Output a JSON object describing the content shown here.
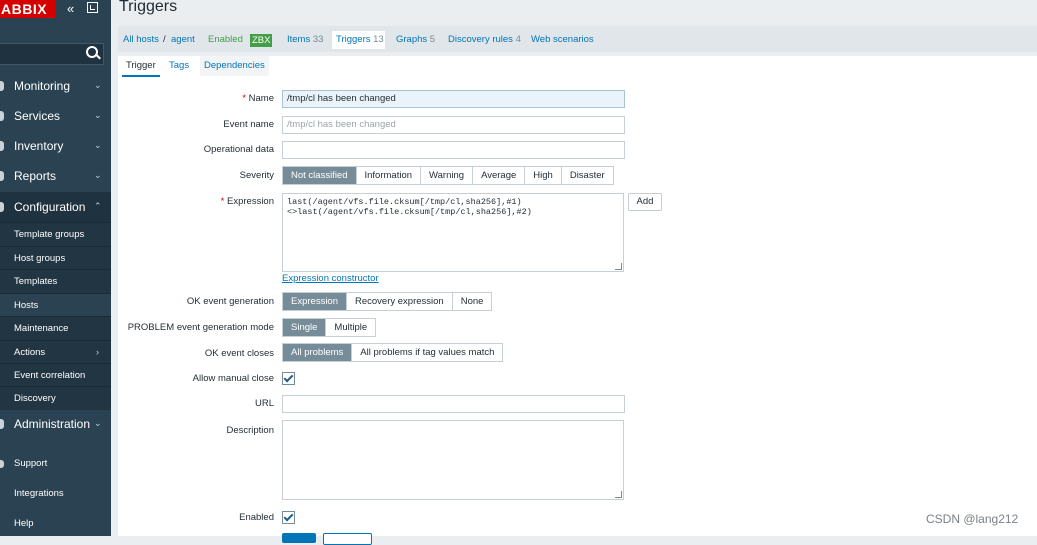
{
  "sidebar": {
    "logo": "ABBIX",
    "collapse_icon": "double-chevron-left-icon",
    "kiosk_icon": "kiosk-mode-icon",
    "search_placeholder": "",
    "menu": [
      {
        "label": "Monitoring"
      },
      {
        "label": "Services"
      },
      {
        "label": "Inventory"
      },
      {
        "label": "Reports"
      },
      {
        "label": "Configuration"
      }
    ],
    "config_items": [
      {
        "label": "Template groups"
      },
      {
        "label": "Host groups"
      },
      {
        "label": "Templates"
      },
      {
        "label": "Hosts"
      },
      {
        "label": "Maintenance"
      },
      {
        "label": "Actions"
      },
      {
        "label": "Event correlation"
      },
      {
        "label": "Discovery"
      }
    ],
    "administration": "Administration",
    "bottom": [
      {
        "label": "Support"
      },
      {
        "label": "Integrations"
      },
      {
        "label": "Help"
      }
    ]
  },
  "header": {
    "title": "Triggers"
  },
  "host_nav": {
    "all_hosts": "All hosts",
    "sep": "/",
    "host": "agent",
    "enabled": "Enabled",
    "zbx": "ZBX",
    "items_label": "Items",
    "items_count": "33",
    "triggers_label": "Triggers",
    "triggers_count": "13",
    "graphs_label": "Graphs",
    "graphs_count": "5",
    "discovery_label": "Discovery rules",
    "discovery_count": "4",
    "web_label": "Web scenarios"
  },
  "tabs": [
    "Trigger",
    "Tags",
    "Dependencies"
  ],
  "form": {
    "name_label": "Name",
    "name_value": "/tmp/cl has been changed",
    "event_name_label": "Event name",
    "event_name_placeholder": "/tmp/cl has been changed",
    "opdata_label": "Operational data",
    "severity_label": "Severity",
    "severity_options": [
      "Not classified",
      "Information",
      "Warning",
      "Average",
      "High",
      "Disaster"
    ],
    "expression_label": "Expression",
    "expression_line1": "last(/agent/vfs.file.cksum[/tmp/cl,sha256],#1)",
    "expression_line2": "<>last(/agent/vfs.file.cksum[/tmp/cl,sha256],#2)",
    "add_button": "Add",
    "expression_constructor": "Expression constructor",
    "ok_event_generation_label": "OK event generation",
    "ok_event_generation_options": [
      "Expression",
      "Recovery expression",
      "None"
    ],
    "problem_mode_label": "PROBLEM event generation mode",
    "problem_mode_options": [
      "Single",
      "Multiple"
    ],
    "ok_event_closes_label": "OK event closes",
    "ok_event_closes_options": [
      "All problems",
      "All problems if tag values match"
    ],
    "allow_manual_close_label": "Allow manual close",
    "url_label": "URL",
    "description_label": "Description",
    "enabled_label": "Enabled"
  },
  "watermark": "CSDN @lang212"
}
